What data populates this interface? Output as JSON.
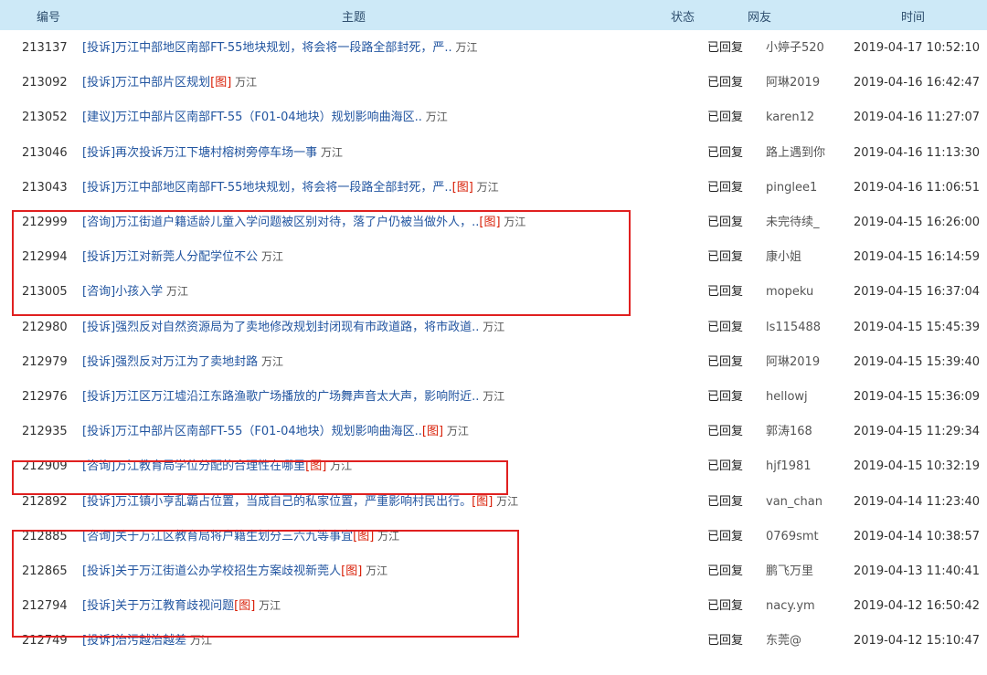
{
  "header": {
    "id": "编号",
    "title": "主题",
    "status": "状态",
    "user": "网友",
    "time": "时间"
  },
  "rows": [
    {
      "id": "213137",
      "cat": "[投诉]",
      "subject": "万江中部地区南部FT-55地块规划，将会将一段路全部封死，严..",
      "img": "",
      "area": "万江",
      "status": "已回复",
      "user": "小婷子520",
      "time": "2019-04-17 10:52:10"
    },
    {
      "id": "213092",
      "cat": "[投诉]",
      "subject": "万江中部片区规划",
      "img": "[图]",
      "area": "万江",
      "status": "已回复",
      "user": "阿琳2019",
      "time": "2019-04-16 16:42:47"
    },
    {
      "id": "213052",
      "cat": "[建议]",
      "subject": "万江中部片区南部FT-55（F01-04地块）规划影响曲海区..",
      "img": "",
      "area": "万江",
      "status": "已回复",
      "user": "karen12",
      "time": "2019-04-16 11:27:07"
    },
    {
      "id": "213046",
      "cat": "[投诉]",
      "subject": "再次投诉万江下塘村榕树旁停车场一事",
      "img": "",
      "area": "万江",
      "status": "已回复",
      "user": "路上遇到你",
      "time": "2019-04-16 11:13:30"
    },
    {
      "id": "213043",
      "cat": "[投诉]",
      "subject": "万江中部地区南部FT-55地块规划，将会将一段路全部封死，严..",
      "img": "[图]",
      "area": "万江",
      "status": "已回复",
      "user": "pinglee1",
      "time": "2019-04-16 11:06:51"
    },
    {
      "id": "212999",
      "cat": "[咨询]",
      "subject": "万江街道户籍适龄儿童入学问题被区别对待，落了户仍被当做外人，..",
      "img": "[图]",
      "area": "万江",
      "status": "已回复",
      "user": "未完待续_",
      "time": "2019-04-15 16:26:00"
    },
    {
      "id": "212994",
      "cat": "[投诉]",
      "subject": "万江对新莞人分配学位不公",
      "img": "",
      "area": "万江",
      "status": "已回复",
      "user": "康小姐",
      "time": "2019-04-15 16:14:59"
    },
    {
      "id": "213005",
      "cat": "[咨询]",
      "subject": "小孩入学",
      "img": "",
      "area": "万江",
      "status": "已回复",
      "user": "mopeku",
      "time": "2019-04-15 16:37:04"
    },
    {
      "id": "212980",
      "cat": "[投诉]",
      "subject": "强烈反对自然资源局为了卖地修改规划封闭现有市政道路，将市政道..",
      "img": "",
      "area": "万江",
      "status": "已回复",
      "user": "ls115488",
      "time": "2019-04-15 15:45:39"
    },
    {
      "id": "212979",
      "cat": "[投诉]",
      "subject": "强烈反对万江为了卖地封路",
      "img": "",
      "area": "万江",
      "status": "已回复",
      "user": "阿琳2019",
      "time": "2019-04-15 15:39:40"
    },
    {
      "id": "212976",
      "cat": "[投诉]",
      "subject": "万江区万江墟沿江东路渔歌广场播放的广场舞声音太大声，影响附近..",
      "img": "",
      "area": "万江",
      "status": "已回复",
      "user": "hellowj",
      "time": "2019-04-15 15:36:09"
    },
    {
      "id": "212935",
      "cat": "[投诉]",
      "subject": "万江中部片区南部FT-55（F01-04地块）规划影响曲海区..",
      "img": "[图]",
      "area": "万江",
      "status": "已回复",
      "user": "郭涛168",
      "time": "2019-04-15 11:29:34"
    },
    {
      "id": "212909",
      "cat": "[咨询]",
      "subject": "万江教育局学位分配的合理性在哪里",
      "img": "[图]",
      "area": "万江",
      "status": "已回复",
      "user": "hjf1981",
      "time": "2019-04-15 10:32:19"
    },
    {
      "id": "212892",
      "cat": "[投诉]",
      "subject": "万江镇小亨乱霸占位置，当成自己的私家位置，严重影响村民出行。",
      "img": "[图]",
      "area": "万江",
      "status": "已回复",
      "user": "van_chan",
      "time": "2019-04-14 11:23:40"
    },
    {
      "id": "212885",
      "cat": "[咨询]",
      "subject": "关于万江区教育局将户籍生划分三六九等事宜",
      "img": "[图]",
      "area": "万江",
      "status": "已回复",
      "user": "0769smt",
      "time": "2019-04-14 10:38:57"
    },
    {
      "id": "212865",
      "cat": "[投诉]",
      "subject": "关于万江街道公办学校招生方案歧视新莞人",
      "img": "[图]",
      "area": "万江",
      "status": "已回复",
      "user": "鹏飞万里",
      "time": "2019-04-13 11:40:41"
    },
    {
      "id": "212794",
      "cat": "[投诉]",
      "subject": "关于万江教育歧视问题",
      "img": "[图]",
      "area": "万江",
      "status": "已回复",
      "user": "nacy.ym",
      "time": "2019-04-12 16:50:42"
    },
    {
      "id": "212749",
      "cat": "[投诉]",
      "subject": "治污越治越差",
      "img": "",
      "area": "万江",
      "status": "已回复",
      "user": "东莞@",
      "time": "2019-04-12 15:10:47"
    }
  ],
  "colors": {
    "header_bg": "#cde9f7",
    "link": "#2255a0",
    "image_tag": "#d81e06",
    "highlight_box": "#e02020"
  }
}
